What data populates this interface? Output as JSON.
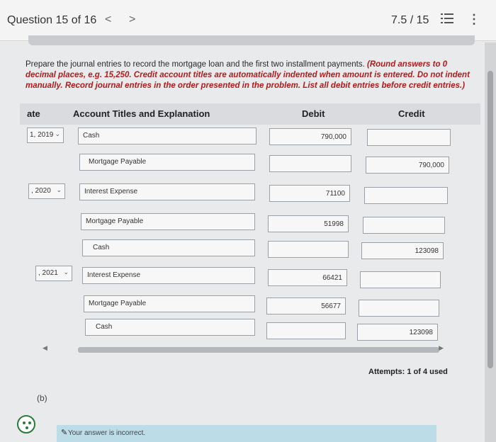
{
  "header": {
    "question_label": "Question 15 of 16",
    "prev_icon": "<",
    "next_icon": ">",
    "score": "7.5 / 15"
  },
  "instructions": {
    "plain": "Prepare the journal entries to record the mortgage loan and the first two installment payments. ",
    "emphasis": "(Round answers to 0 decimal places, e.g. 15,250. Credit account titles are automatically indented when amount is entered. Do not indent manually. Record journal entries in the order presented in the problem. List all debit entries before credit entries.)"
  },
  "table": {
    "headers": {
      "date": "ate",
      "account": "Account Titles and Explanation",
      "debit": "Debit",
      "credit": "Credit"
    },
    "rows": [
      {
        "date": "1, 2019",
        "account": "Cash",
        "debit": "790,000",
        "credit": ""
      },
      {
        "date": "",
        "account": "Mortgage Payable",
        "debit": "",
        "credit": "790,000"
      },
      {
        "date": ", 2020",
        "account": "Interest Expense",
        "debit": "71100",
        "credit": ""
      },
      {
        "date": "",
        "account": "Mortgage Payable",
        "debit": "51998",
        "credit": ""
      },
      {
        "date": "",
        "account": "Cash",
        "debit": "",
        "credit": "123098"
      },
      {
        "date": ", 2021",
        "account": "Interest Expense",
        "debit": "66421",
        "credit": ""
      },
      {
        "date": "",
        "account": "Mortgage Payable",
        "debit": "56677",
        "credit": ""
      },
      {
        "date": "",
        "account": "Cash",
        "debit": "",
        "credit": "123098"
      }
    ]
  },
  "attempts": "Attempts: 1 of 4 used",
  "part_b": "(b)",
  "feedback": "Your answer is incorrect.",
  "icons": {
    "list": "list-icon",
    "more": "more-vertical-icon",
    "feedback": "feedback-face-icon",
    "pencil": "pencil-icon"
  },
  "colors": {
    "emphasis": "#b01c1c",
    "feedback_bar": "#bcdce8",
    "header_bg": "#d9dbde"
  }
}
